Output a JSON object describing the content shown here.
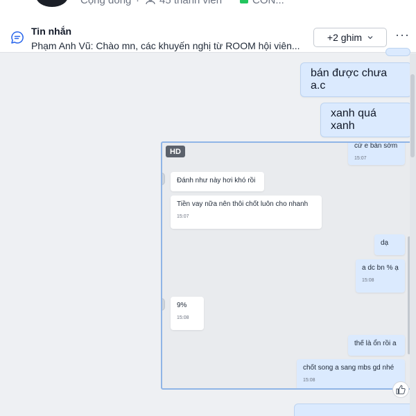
{
  "header": {
    "community_label": "Cộng đồng",
    "separator": "·",
    "members_label": "45 thành viên",
    "chat_label": "CON..."
  },
  "pin_bar": {
    "title": "Tin nhắn",
    "preview": "Phạm Anh Vũ: Chào mn, các khuyến nghị từ ROOM hội viên...",
    "pinned_button": "+2 ghim",
    "more": "···",
    "icons": {
      "message": "message-icon",
      "chevron": "chevron-down-icon",
      "more": "more-icon"
    }
  },
  "messages": [
    {
      "text": "bán được chưa a.c"
    },
    {
      "text": "xanh quá xanh"
    }
  ],
  "embedded_image": {
    "badge": "HD",
    "bubbles": [
      {
        "text": "cứ e bán sớm",
        "time": "15:07"
      },
      {
        "text": "Đánh như này hơi khó rồi"
      },
      {
        "text": "Tiền vay nữa nên thôi chốt luôn cho nhanh",
        "time": "15:07"
      },
      {
        "text": "dạ"
      },
      {
        "text": "a dc bn % ạ",
        "time": "15:08"
      },
      {
        "text": "9%",
        "time": "15:08"
      },
      {
        "text": "thế là ổn rồi a"
      },
      {
        "text": "chốt song a sang mbs gd nhé",
        "time": "15:08"
      }
    ]
  },
  "actions": {
    "like_icon": "thumbs-up-icon"
  },
  "colors": {
    "bubble_bg": "#dbeafe",
    "bubble_border": "#bcd3f0",
    "chat_bg": "#eef0f3",
    "accent": "#8fb4e6"
  }
}
